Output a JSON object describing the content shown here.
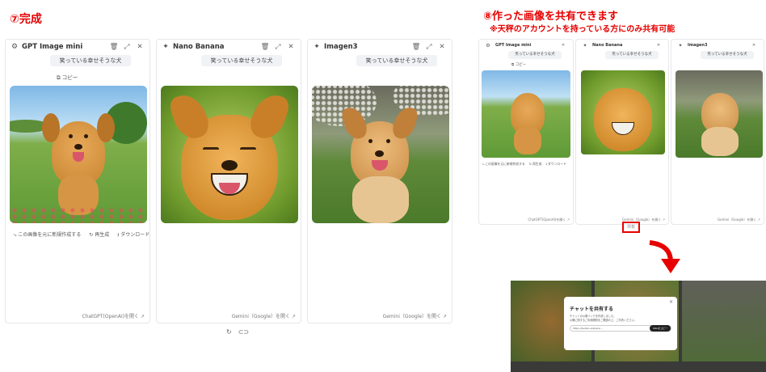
{
  "headings": {
    "left": "⑦完成",
    "right": "⑧作った画像を共有できます",
    "note": "※天秤のアカウントを持っている方にのみ共有可能"
  },
  "panels": [
    {
      "id": "gpt",
      "title": "GPT Image mini",
      "prompt": "笑っている幸せそうな犬",
      "copy_label": "コピー",
      "actions": [
        "この画像を元に新規作成する",
        "再生成",
        "ダウンロード"
      ],
      "footer": "ChatGPT(OpenAI)を開く"
    },
    {
      "id": "nano",
      "title": "Nano Banana",
      "prompt": "笑っている幸せそうな犬",
      "footer": ""
    },
    {
      "id": "imagen",
      "title": "Imagen3",
      "prompt": "笑っている幸せそうな犬",
      "footer": "Gemini（Google）を開く"
    }
  ],
  "middle_footer": "Gemini（Google）を開く",
  "share_bar": {
    "regen_icon": "↻",
    "link_icon": "⊂⊃"
  },
  "mini_panels": [
    {
      "title": "GPT Image mini",
      "prompt": "笑っている幸せそうな犬",
      "copy_label": "コピー",
      "actions": [
        "この画像を元に新規作成する",
        "再生成",
        "ダウンロード"
      ],
      "footer": "ChatGPT(OpenAI)を開く"
    },
    {
      "title": "Nano Banana",
      "prompt": "笑っている幸せそうな犬",
      "footer": "Gemini（Google）を開く"
    },
    {
      "title": "Imagen3",
      "prompt": "笑っている幸せそうな犬",
      "footer": "Gemini（Google）を開く"
    }
  ],
  "mini_share_label": "共有",
  "modal": {
    "title": "チャットを共有する",
    "desc1": "チャットの公開リンクを作成しました。",
    "desc2": "公開に関するご利用規約をご確認の上、ご共有ください。",
    "url": "https://tenbin.ai/share/...",
    "copy_button": "URLをコピー",
    "close": "×"
  },
  "colors": {
    "heading": "#e60000",
    "border": "#e6e7eb",
    "prompt_bg": "#f1f2f5"
  }
}
